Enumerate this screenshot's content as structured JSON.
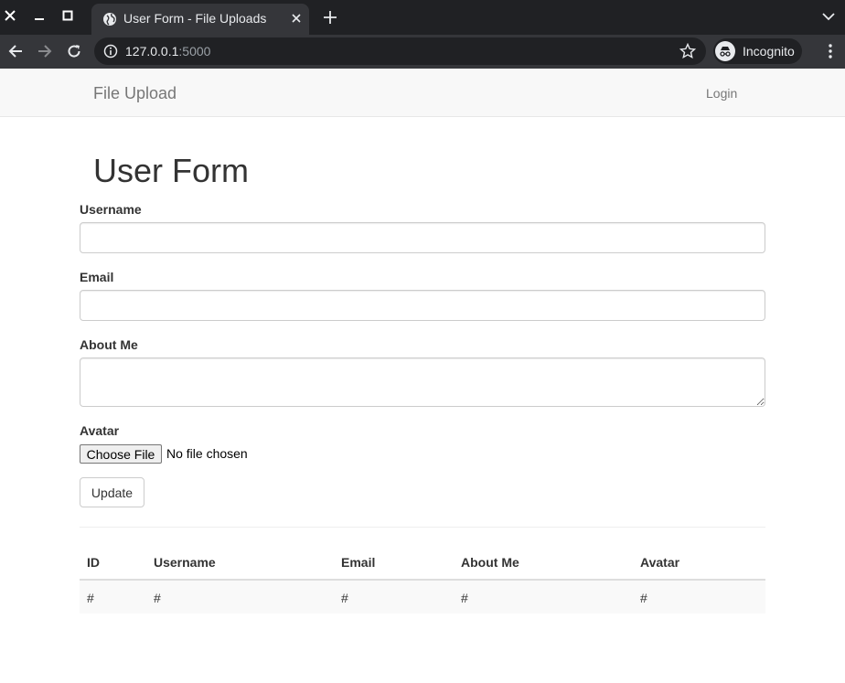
{
  "browser": {
    "tab_title": "User Form - File Uploads",
    "url_host": "127.0.0.1",
    "url_port": ":5000",
    "incognito_label": "Incognito"
  },
  "navbar": {
    "brand": "File Upload",
    "login": "Login"
  },
  "form": {
    "title": "User Form",
    "username_label": "Username",
    "username_value": "",
    "email_label": "Email",
    "email_value": "",
    "about_label": "About Me",
    "about_value": "",
    "avatar_label": "Avatar",
    "choose_file_label": "Choose File",
    "file_status": "No file chosen",
    "update_label": "Update"
  },
  "table": {
    "headers": [
      "ID",
      "Username",
      "Email",
      "About Me",
      "Avatar"
    ],
    "rows": [
      [
        "#",
        "#",
        "#",
        "#",
        "#"
      ]
    ]
  },
  "colors": {
    "chrome_dark": "#202124",
    "chrome_tab": "#35363a",
    "navbar_bg": "#f8f8f8",
    "text": "#333333"
  }
}
